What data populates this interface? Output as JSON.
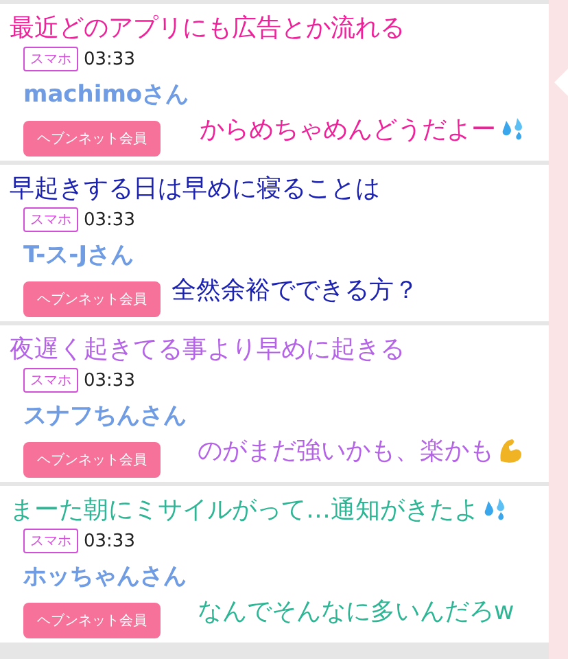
{
  "posts": [
    {
      "badge": "スマホ",
      "time": "03:33",
      "name": "machimoさん",
      "member_label": "ヘブンネット会員",
      "overlay": {
        "color": "#f0209a",
        "lines": [
          {
            "text": "最近どのアプリにも広告とか流れる",
            "kind": "plain"
          },
          {
            "text": "からめちゃめんどうだよー",
            "kind": "sweat-drops"
          }
        ]
      }
    },
    {
      "badge": "スマホ",
      "time": "03:33",
      "name": "T-ス-Jさん",
      "member_label": "ヘブンネット会員",
      "overlay": {
        "color": "#1c22b0",
        "lines": [
          {
            "text": "早起きする日は早めに寝ることは",
            "kind": "plain"
          },
          {
            "text": "全然余裕でできる方？",
            "kind": "plain"
          }
        ]
      }
    },
    {
      "badge": "スマホ",
      "time": "03:33",
      "name": "スナフちんさん",
      "member_label": "ヘブンネット会員",
      "overlay": {
        "color": "#b462e6",
        "lines": [
          {
            "text": "夜遅く起きてる事より早めに起きる",
            "kind": "plain"
          },
          {
            "text": "のがまだ強いかも、楽かも",
            "kind": "flexed-arm"
          }
        ]
      }
    },
    {
      "badge": "スマホ",
      "time": "03:33",
      "name": "ホッちゃんさん",
      "member_label": "ヘブンネット会員",
      "overlay": {
        "color": "#2db594",
        "lines": [
          {
            "text": "まーた朝にミサイルがって…通知がきたよ",
            "kind": "sweat-drops"
          },
          {
            "text": "なんでそんなに多いんだろw",
            "kind": "plain"
          }
        ]
      }
    }
  ]
}
